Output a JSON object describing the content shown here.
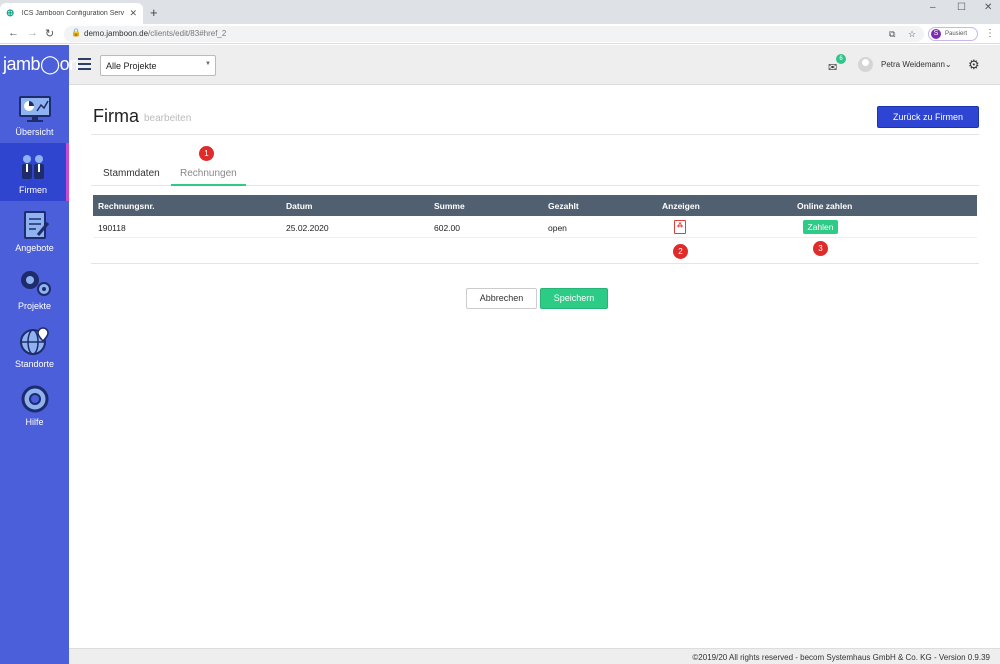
{
  "browser": {
    "tab_title": "ICS Jamboon Configuration Serv",
    "tab_close": "✕",
    "new_tab": "+",
    "url_host": "demo.jamboon.de",
    "url_path": "/clients/edit/83#href_2",
    "profile_initial": "S",
    "profile_label": "Pausiert"
  },
  "header": {
    "logo": "jamb◯on",
    "project_select": "Alle Projekte",
    "mail_badge": "6",
    "user_name": "Petra Weidemann"
  },
  "sidebar": {
    "items": [
      {
        "label": "Übersicht",
        "icon": "dashboard-icon"
      },
      {
        "label": "Firmen",
        "icon": "people-icon",
        "active": true
      },
      {
        "label": "Angebote",
        "icon": "document-pen-icon"
      },
      {
        "label": "Projekte",
        "icon": "gears-icon"
      },
      {
        "label": "Standorte",
        "icon": "globe-pin-icon"
      },
      {
        "label": "Hilfe",
        "icon": "lifebuoy-icon"
      }
    ]
  },
  "page": {
    "title": "Firma",
    "subtitle": "bearbeiten",
    "back_button": "Zurück zu Firmen"
  },
  "tabs": [
    {
      "label": "Stammdaten"
    },
    {
      "label": "Rechnungen",
      "active": true
    }
  ],
  "markers": [
    "1",
    "2",
    "3"
  ],
  "table": {
    "headers": [
      "Rechnungsnr.",
      "Datum",
      "Summe",
      "Gezahlt",
      "Anzeigen",
      "Online zahlen"
    ],
    "rows": [
      {
        "number": "190118",
        "date": "25.02.2020",
        "sum": "602.00",
        "paid": "open",
        "pay_label": "Zahlen"
      }
    ]
  },
  "actions": {
    "cancel": "Abbrechen",
    "save": "Speichern"
  },
  "footer": "©2019/20 All rights reserved - becom Systemhaus GmbH & Co. KG - Version 0.9.39",
  "colors": {
    "sidebar": "#4a5fd9",
    "accent_green": "#2ccb86",
    "primary_blue": "#2d45d2",
    "table_header": "#516070",
    "marker_red": "#e02b2b"
  }
}
